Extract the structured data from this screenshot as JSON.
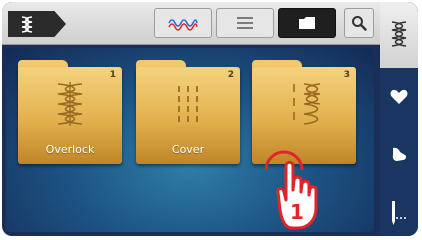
{
  "topbar": {
    "mode_tag_icon": "stitch-pattern-icon",
    "tabs": [
      {
        "icon": "wavy-stitch-icon",
        "active": false
      },
      {
        "icon": "list-lines-icon",
        "active": false
      },
      {
        "icon": "folder-icon",
        "active": true
      }
    ],
    "search_icon": "search-icon"
  },
  "folders": [
    {
      "number": "1",
      "label": "Overlock",
      "icon": "overlock-stitch-icon"
    },
    {
      "number": "2",
      "label": "Cover",
      "icon": "cover-stitch-icon"
    },
    {
      "number": "3",
      "label": "",
      "icon": "decorative-stitch-icon"
    }
  ],
  "sidebar": {
    "top_icon": "stitch-pattern-icon",
    "buttons": [
      {
        "icon": "heart-icon"
      },
      {
        "icon": "sewing-hand-icon"
      },
      {
        "icon": "needle-icon"
      }
    ]
  },
  "overlay": {
    "gesture_icon": "tap-hand-icon",
    "step_number": "1"
  },
  "colors": {
    "background": "#1b2e58",
    "folder_gold": "#e2b14e",
    "accent_red": "#e0242a"
  }
}
